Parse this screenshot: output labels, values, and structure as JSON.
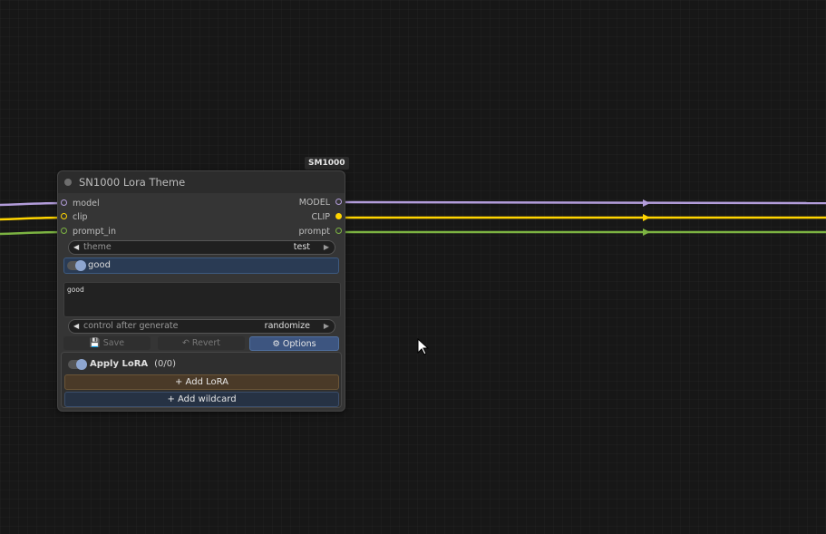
{
  "badge": {
    "text": "SM1000"
  },
  "node": {
    "title": "SN1000 Lora Theme",
    "inputs": [
      {
        "label": "model",
        "color": "#b39ddb"
      },
      {
        "label": "clip",
        "color": "#ffd500"
      },
      {
        "label": "prompt_in",
        "color": "#7cb342"
      }
    ],
    "outputs": [
      {
        "label": "MODEL",
        "color": "#b39ddb"
      },
      {
        "label": "CLIP",
        "color": "#ffd500"
      },
      {
        "label": "prompt",
        "color": "#7cb342"
      }
    ],
    "theme_combo": {
      "label": "theme",
      "value": "test"
    },
    "good_toggle": {
      "label": "good",
      "enabled": true
    },
    "text_value": "good",
    "control_combo": {
      "label": "control after generate",
      "value": "randomize"
    },
    "buttons": {
      "save": "💾 Save",
      "revert": "↶ Revert",
      "options": "⚙ Options"
    },
    "lora": {
      "apply_label": "Apply LoRA",
      "count": "(0/0)",
      "add_lora": "+ Add LoRA",
      "add_wildcard": "+ Add wildcard"
    }
  },
  "link_colors": {
    "model": "#b39ddb",
    "clip": "#ffd500",
    "prompt": "#7cb342"
  }
}
